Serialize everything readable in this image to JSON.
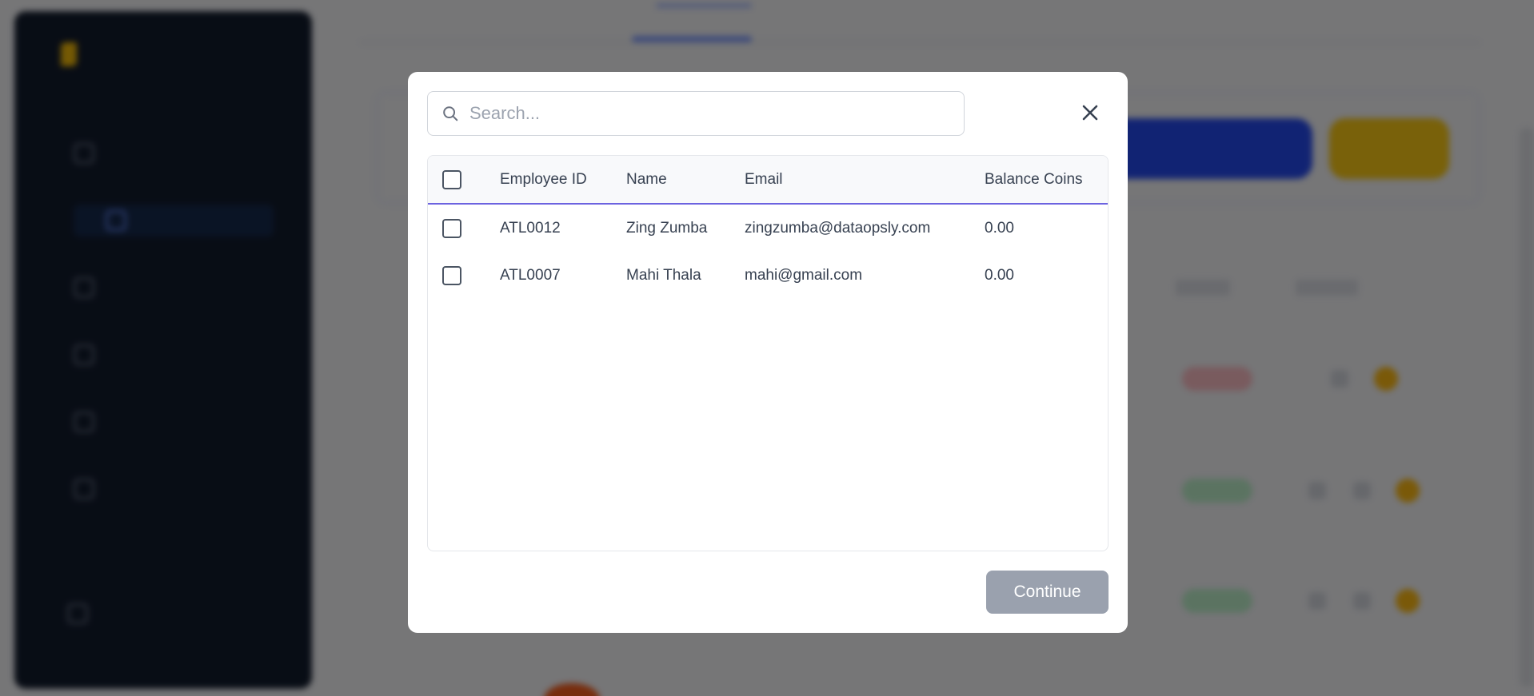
{
  "modal": {
    "search": {
      "placeholder": "Search..."
    },
    "table": {
      "columns": [
        "Employee ID",
        "Name",
        "Email",
        "Balance Coins"
      ],
      "rows": [
        {
          "id": "ATL0012",
          "name": "Zing Zumba",
          "email": "zingzumba@dataopsly.com",
          "coins": "0.00"
        },
        {
          "id": "ATL0007",
          "name": "Mahi Thala",
          "email": "mahi@gmail.com",
          "coins": "0.00"
        }
      ]
    },
    "continue_label": "Continue"
  },
  "colors": {
    "overlay": "rgba(0,0,0,0.5)",
    "header_underline": "#6c63e0",
    "continue_disabled": "#9aa1ae",
    "sidebar_bg": "#111a2b"
  }
}
